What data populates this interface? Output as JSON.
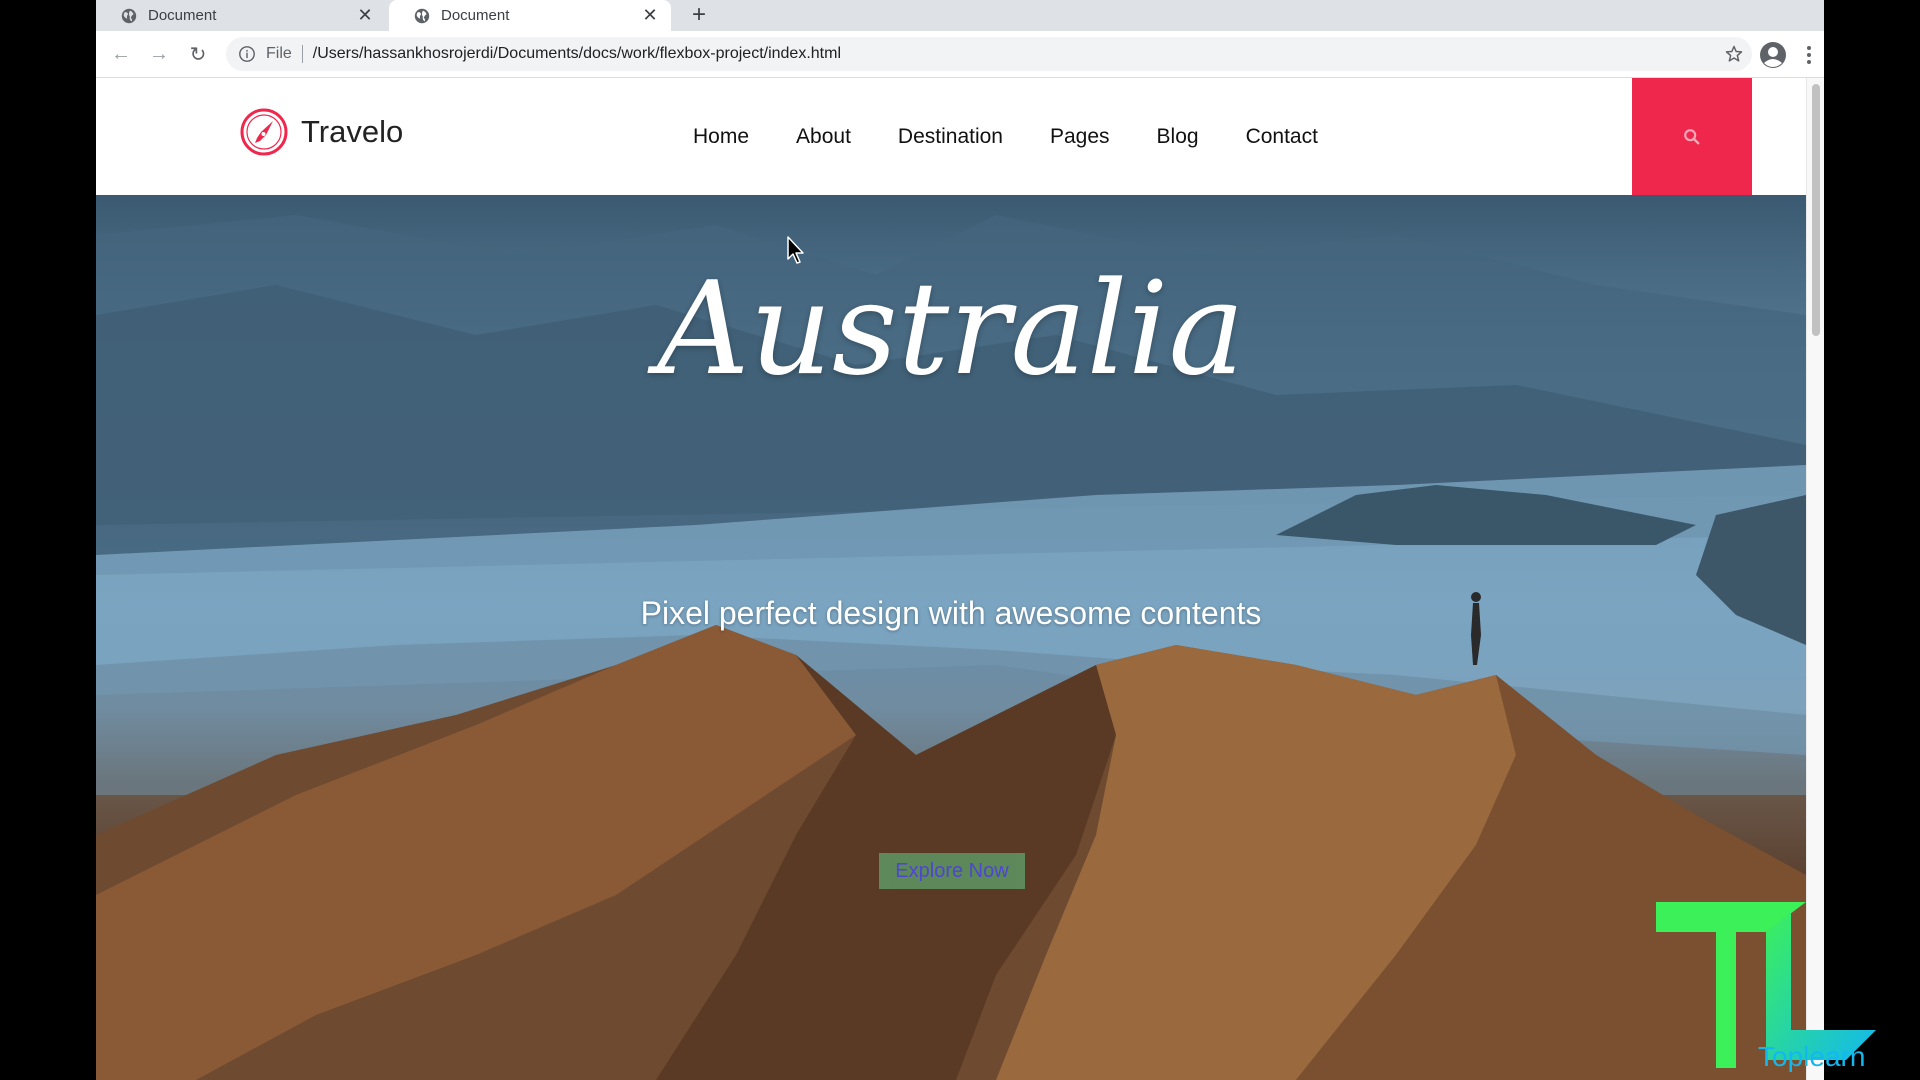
{
  "browser": {
    "tabs": [
      {
        "title": "Document",
        "icon": "globe-icon",
        "active": false
      },
      {
        "title": "Document",
        "icon": "globe-icon",
        "active": true
      }
    ],
    "scheme_label": "File",
    "url": "/Users/hassankhosrojerdi/Documents/docs/work/flexbox-project/index.html"
  },
  "site": {
    "brand": "Travelo",
    "nav": [
      "Home",
      "About",
      "Destination",
      "Pages",
      "Blog",
      "Contact"
    ],
    "accent_color": "#f0274d"
  },
  "hero": {
    "title": "Australia",
    "subtitle": "Pixel perfect design with awesome contents",
    "cta": "Explore Now"
  },
  "watermark": {
    "text": "Toplearn"
  }
}
